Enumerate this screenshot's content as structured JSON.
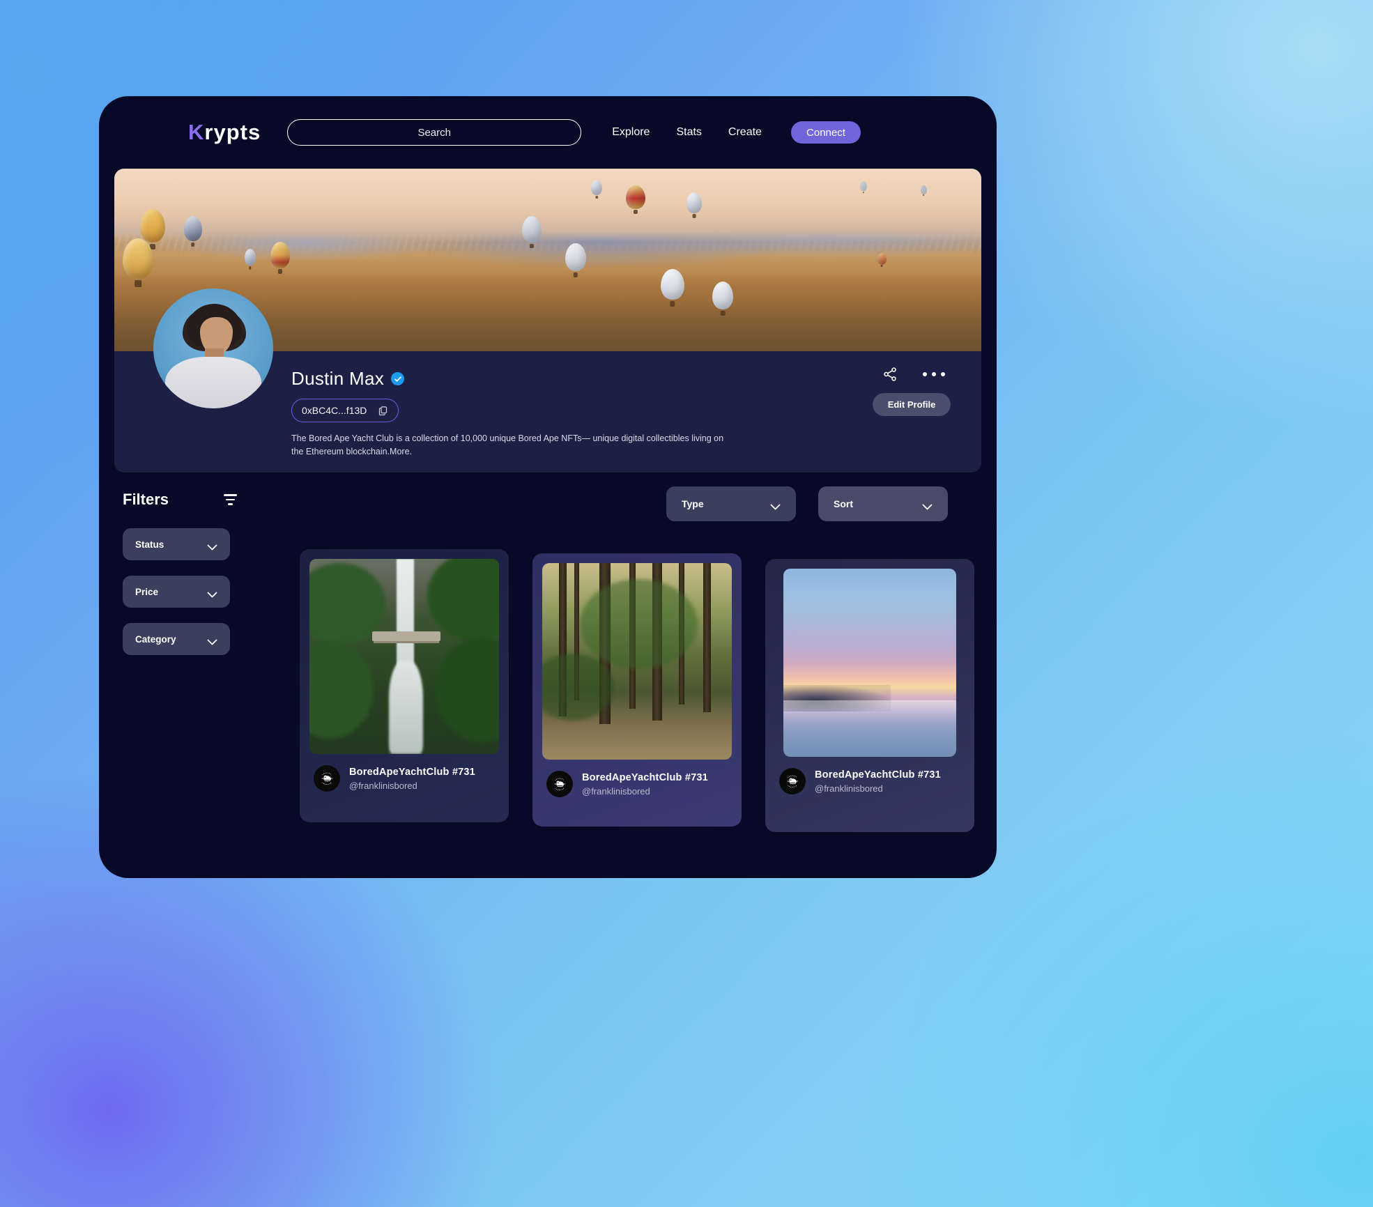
{
  "header": {
    "logo_k": "K",
    "logo_rest": "rypts",
    "search_placeholder": "Search",
    "nav": [
      {
        "label": "Explore"
      },
      {
        "label": "Stats"
      },
      {
        "label": "Create"
      }
    ],
    "connect_label": "Connect"
  },
  "profile": {
    "name": "Dustin Max",
    "verified": true,
    "address": "0xBC4C...f13D",
    "description": "The Bored Ape Yacht Club is a collection of 10,000 unique Bored Ape NFTs— unique digital collectibles living on the Ethereum blockchain.More.",
    "edit_label": "Edit Profile",
    "share_icon": "share-icon",
    "more_icon": "more-dots-icon",
    "copy_icon": "copy-icon"
  },
  "filters": {
    "title": "Filters",
    "filter_icon": "filter-lines-icon",
    "dropdowns": [
      {
        "label": "Status"
      },
      {
        "label": "Price"
      },
      {
        "label": "Category"
      }
    ]
  },
  "toolbar": {
    "type_label": "Type",
    "sort_label": "Sort"
  },
  "cards": [
    {
      "title": "BoredApeYachtClub #731",
      "owner": "@franklinisbored",
      "image": "waterfall-photo"
    },
    {
      "title": "BoredApeYachtClub #731",
      "owner": "@franklinisbored",
      "image": "forest-path-photo"
    },
    {
      "title": "BoredApeYachtClub #731",
      "owner": "@franklinisbored",
      "image": "sunset-beach-photo"
    }
  ],
  "colors": {
    "accent_purple": "#6F66DC",
    "logo_purple": "#8B6EF0",
    "panel_bg": "#070A26",
    "profile_card_bg": "#1C2044",
    "dropdown_bg": "#3B3F5E",
    "verified_blue": "#1D9BF0"
  }
}
